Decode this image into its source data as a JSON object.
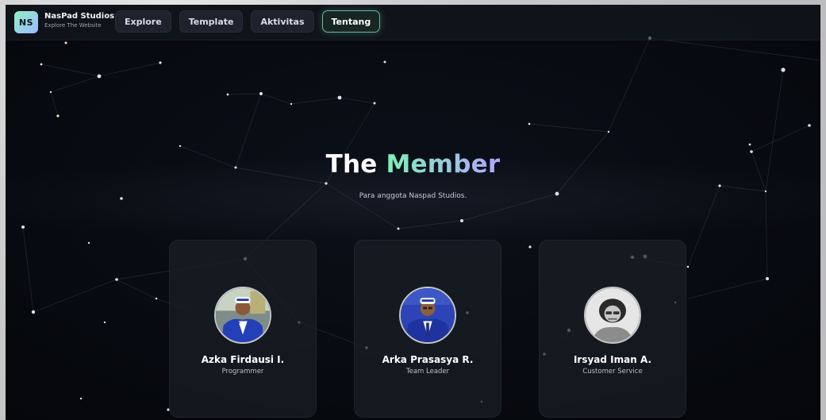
{
  "nav": {
    "logo_text": "NS",
    "brand_title": "NasPad Studios",
    "brand_subtitle": "Explore The Website",
    "tabs": [
      {
        "label": "Explore",
        "active": false
      },
      {
        "label": "Template",
        "active": false
      },
      {
        "label": "Aktivitas",
        "active": false
      },
      {
        "label": "Tentang",
        "active": true
      }
    ]
  },
  "hero": {
    "title_part1": "The",
    "title_part2": "Member",
    "subtitle": "Para anggota Naspad Studios."
  },
  "members": [
    {
      "name": "Azka Firdausi I.",
      "role": "Programmer",
      "avatar": "photo-blue-uniform"
    },
    {
      "name": "Arka Prasasya R.",
      "role": "Team Leader",
      "avatar": "photo-blue-uniform"
    },
    {
      "name": "Irsyad Iman A.",
      "role": "Customer Service",
      "avatar": "photo-grayscale"
    }
  ],
  "colors": {
    "accent_green": "#7ef1b5",
    "accent_purple": "#b2a6ff",
    "background": "#06080d"
  }
}
